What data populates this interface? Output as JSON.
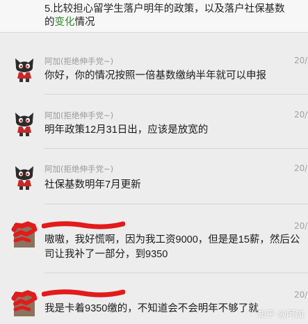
{
  "top_message": {
    "line1": "5.比较担心留学生落户明年的政策，以及落户社保基数",
    "line2_prefix": "的",
    "line2_highlight": "变化",
    "line2_suffix": "情况"
  },
  "messages": [
    {
      "sender": "阿加(拒绝伸手党~)",
      "date": "20/",
      "text": "你好，你的情况按照一倍基数缴纳半年就可以申报"
    },
    {
      "sender": "阿加(拒绝伸手党~)",
      "date": "20/",
      "text": "明年政策12月31日出，应该是放宽的"
    },
    {
      "sender": "阿加(拒绝伸手党~)",
      "date": "20/",
      "text": "社保基数明年7月更新"
    },
    {
      "sender": "",
      "date": "20/",
      "text": "嗷嗷，我好慌啊，因为我工资9000，但是是15薪，然后公司让我补了一部分，到9350"
    },
    {
      "sender": "",
      "date": "20/",
      "text": "我是卡着9350缴的，不知道会不会明年不够了就"
    }
  ],
  "watermark": "知乎 @阿加",
  "colors": {
    "highlight": "#2e8b2e",
    "background": "#ededed",
    "redact": "#e21b1b"
  }
}
